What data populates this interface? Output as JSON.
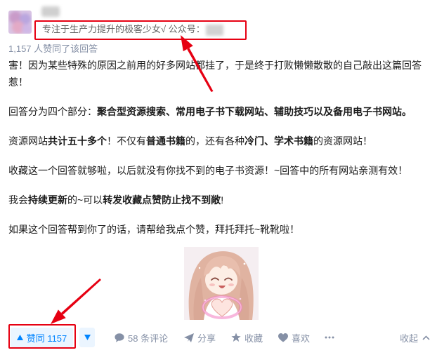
{
  "headline": {
    "text": "专注于生产力提升的极客少女√ 公众号："
  },
  "vote_summary": "1,157 人赞同了该回答",
  "body": {
    "p1": [
      "害！因为某些特殊的原因之前用的好多网站都挂了，于是终于打败懒懒散散的自己敲出这篇回答惹！"
    ],
    "p2": [
      "回答分为四个部分：",
      "聚合型资源搜索、常用电子书下载网站、辅助技巧以及备用电子书网站。"
    ],
    "p3": [
      "资源网站",
      "共计五十多个",
      "！不仅有",
      "普通书籍",
      "的，还有各种",
      "冷门、学术书籍",
      "的资源网站！"
    ],
    "p4": [
      "收藏这一个回答就够啦，以后就没有你找不到的电子书资源！~回答中的所有网站亲测有效！"
    ],
    "p5": [
      "我会",
      "持续更新",
      "的~可以",
      "转发收藏点赞防止找不到敞",
      "!"
    ],
    "p6": [
      "如果这个回答帮到你了的话，请帮给我点个赞，拜托拜托~靴靴啦！"
    ]
  },
  "actions": {
    "upvote_label": "赞同 1157",
    "comments_label": "58 条评论",
    "share_label": "分享",
    "collect_label": "收藏",
    "like_label": "喜欢",
    "collapse_label": "收起"
  },
  "icons": {
    "upvote": "upvote-arrow-icon",
    "downvote": "downvote-arrow-icon",
    "comments": "comment-icon",
    "share": "share-icon",
    "collect": "star-icon",
    "like": "heart-icon",
    "more": "more-icon",
    "collapse": "chevron-up-icon"
  },
  "colors": {
    "accent": "#0084ff",
    "accent_background": "#ebf5ff",
    "muted_text": "#8590a6",
    "body_text": "#1a1a1a",
    "annotation_red": "#e60012"
  }
}
